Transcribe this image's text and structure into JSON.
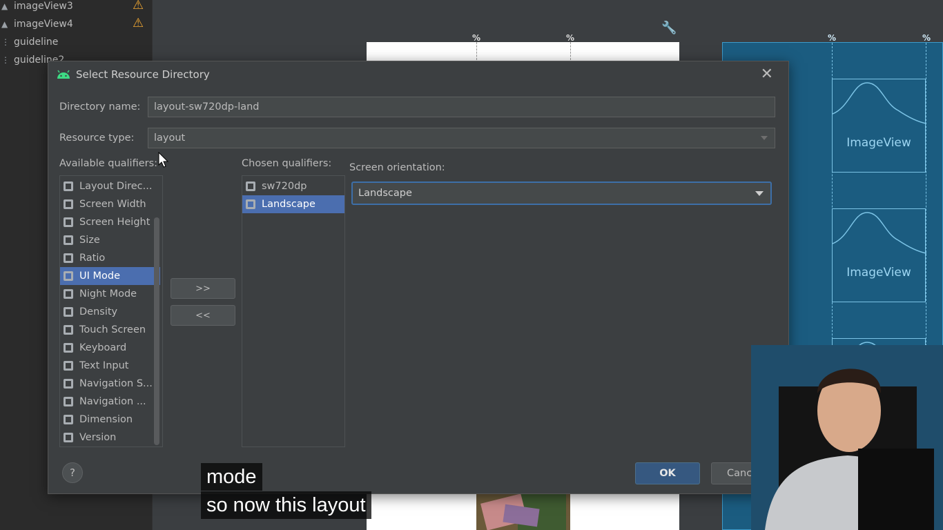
{
  "project_tree": {
    "items": [
      {
        "label": "imageView3",
        "icon": "image-icon",
        "warning": true
      },
      {
        "label": "imageView4",
        "icon": "image-icon",
        "warning": true
      },
      {
        "label": "guideline",
        "icon": "guideline-icon",
        "warning": false
      },
      {
        "label": "guideline2",
        "icon": "guideline-icon",
        "warning": false
      }
    ]
  },
  "canvas": {
    "percent_marker": "%",
    "blueprint_label": "ImageView"
  },
  "dialog": {
    "title": "Select Resource Directory",
    "directory_name_label": "Directory name:",
    "directory_name_value": "layout-sw720dp-land",
    "resource_type_label": "Resource type:",
    "resource_type_value": "layout",
    "available_label": "Available qualifiers:",
    "chosen_label": "Chosen qualifiers:",
    "available_qualifiers": [
      "Layout Direc...",
      "Screen Width",
      "Screen Height",
      "Size",
      "Ratio",
      "UI Mode",
      "Night Mode",
      "Density",
      "Touch Screen",
      "Keyboard",
      "Text Input",
      "Navigation S...",
      "Navigation ...",
      "Dimension",
      "Version"
    ],
    "available_selected": "UI Mode",
    "chosen_qualifiers": [
      "sw720dp",
      "Landscape"
    ],
    "chosen_selected": "Landscape",
    "add_button": ">>",
    "remove_button": "<<",
    "orientation_label": "Screen orientation:",
    "orientation_value": "Landscape",
    "help_button": "?",
    "ok_button": "OK",
    "cancel_button": "Cancel"
  },
  "subtitles": {
    "line1": "mode",
    "line2": "so now this layout"
  },
  "colors": {
    "selection": "#4b6eaf",
    "focus_border": "#3d6fa8",
    "warning": "#f0a732",
    "blueprint": "#1b5c80",
    "android_green": "#3ddc84"
  }
}
